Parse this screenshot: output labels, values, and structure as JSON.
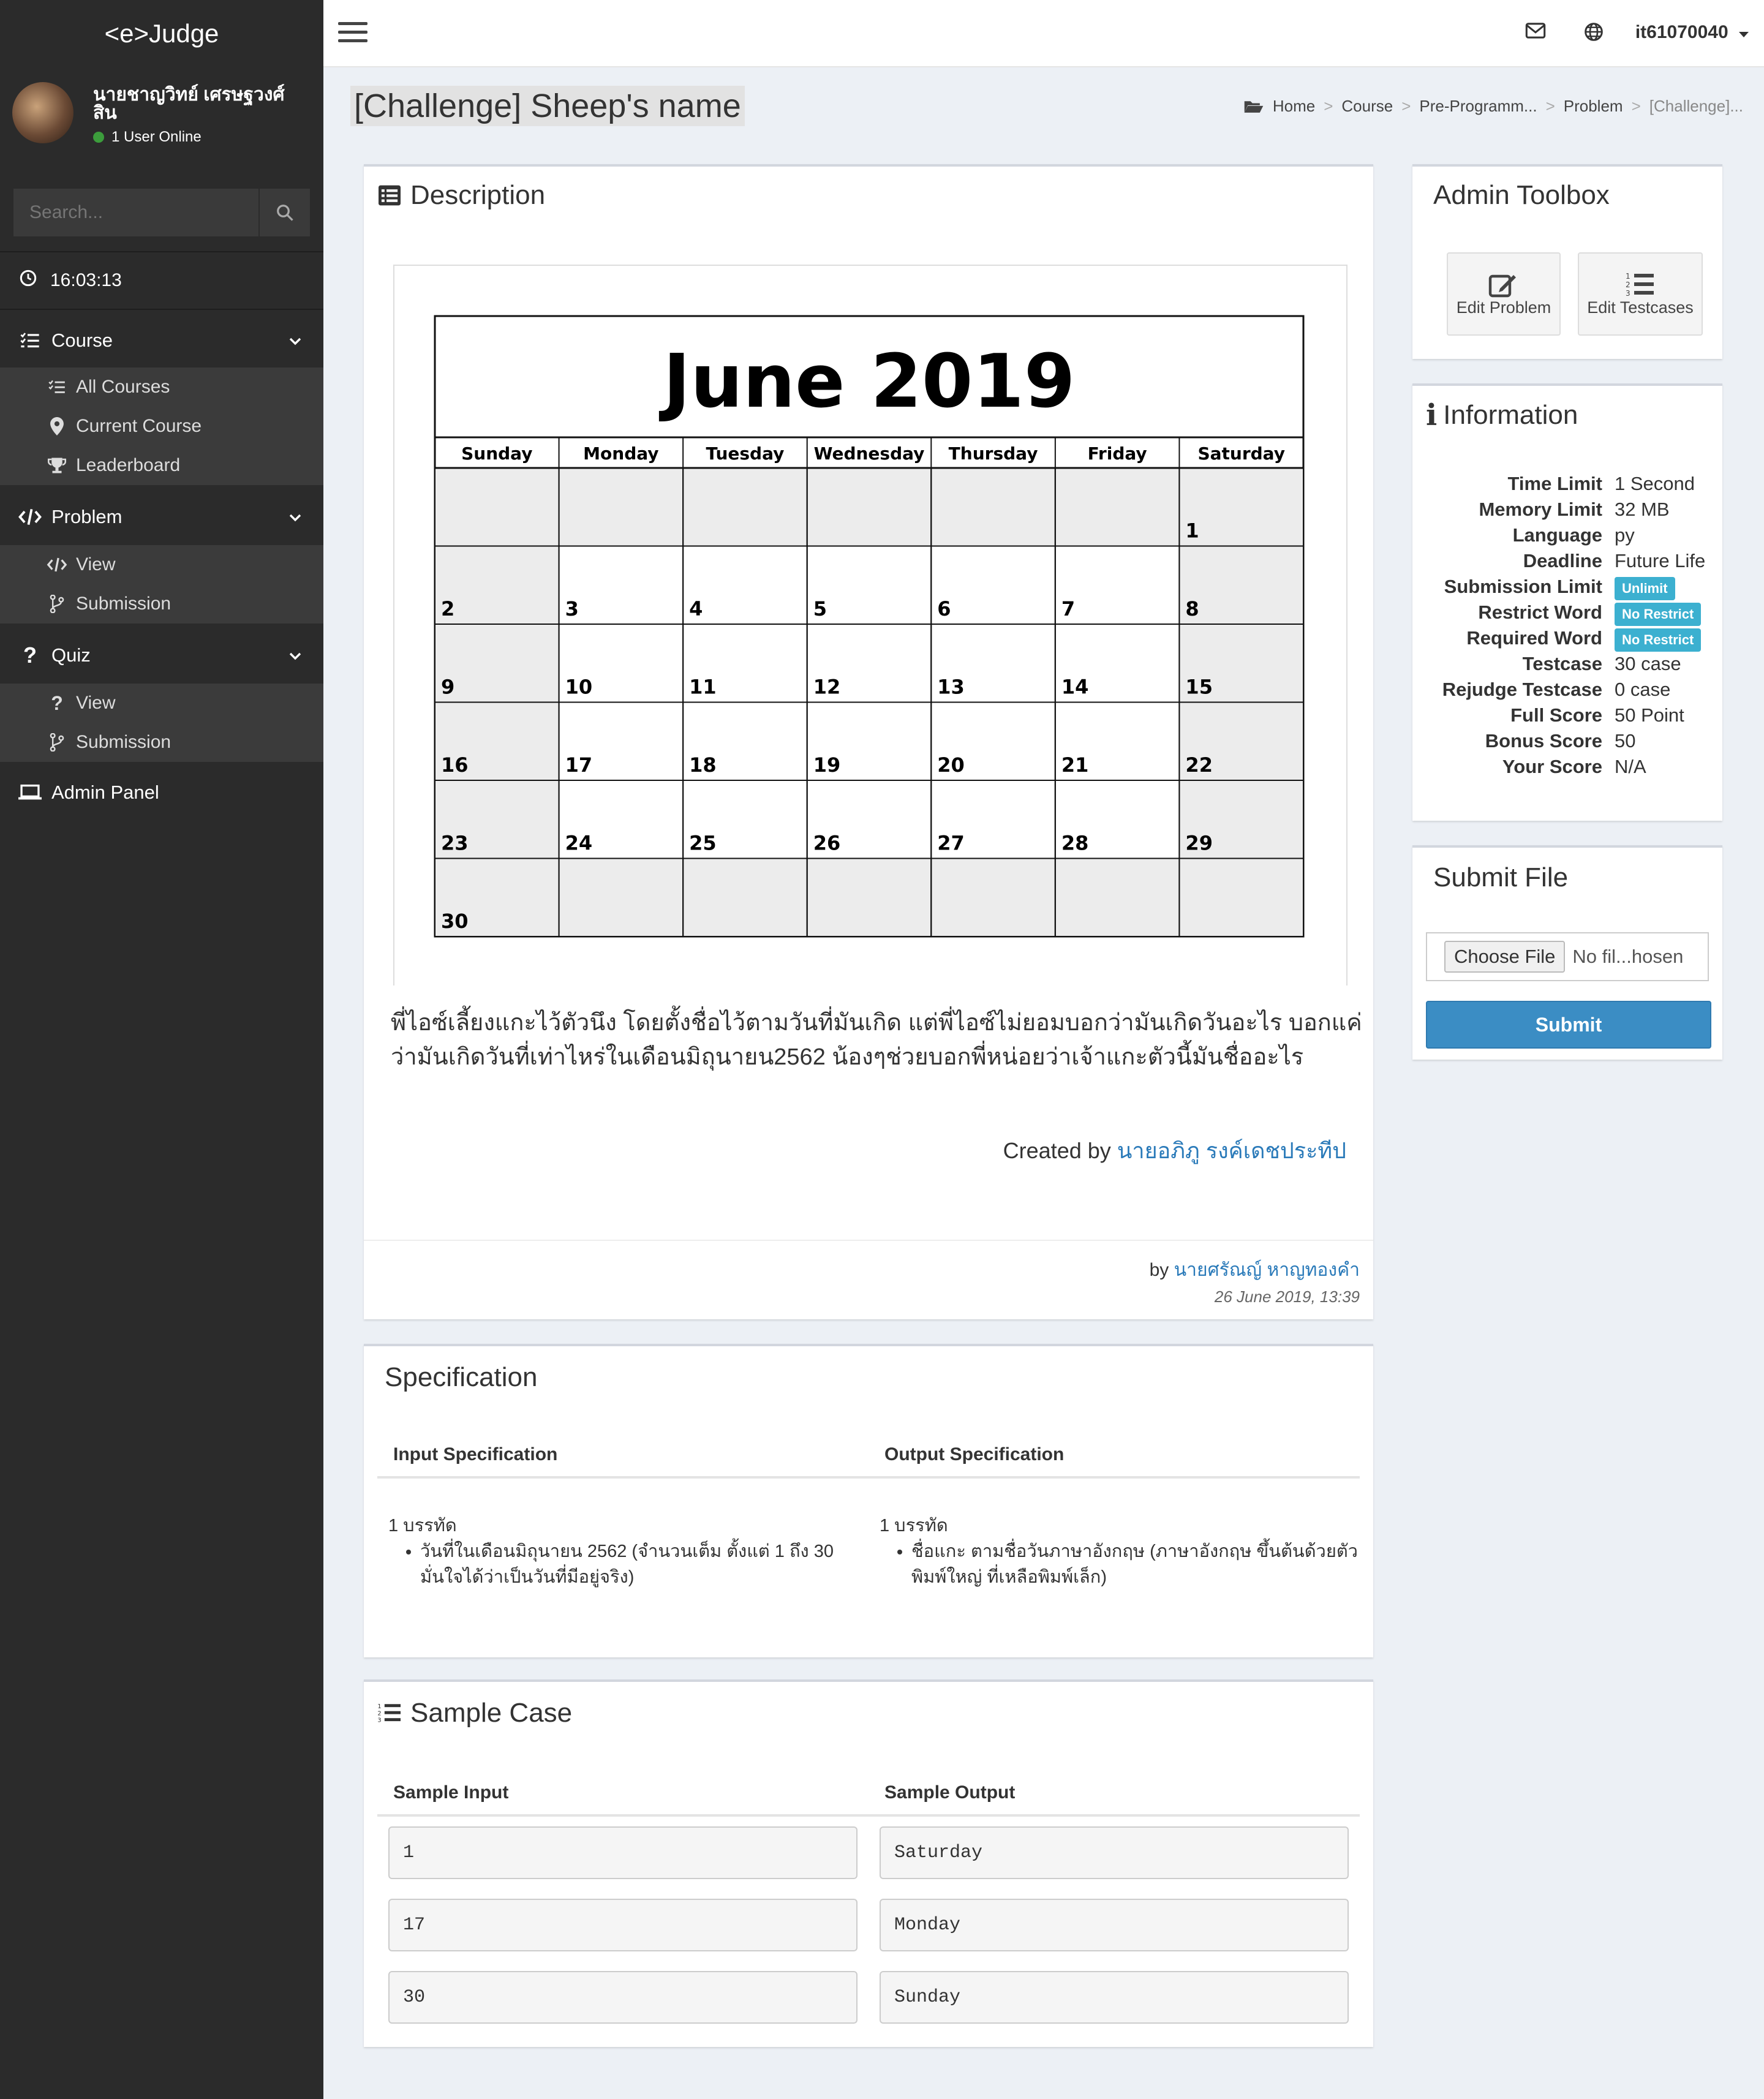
{
  "sidebar": {
    "brand": "<e>Judge",
    "user_name": "นายชาญวิทย์ เศรษฐวงศ์สิน",
    "online_text": "1 User Online",
    "search_placeholder": "Search...",
    "clock": "16:03:13",
    "course": {
      "label": "Course",
      "items": [
        "All Courses",
        "Current Course",
        "Leaderboard"
      ]
    },
    "problem": {
      "label": "Problem",
      "items": [
        "View",
        "Submission"
      ]
    },
    "quiz": {
      "label": "Quiz",
      "items": [
        "View",
        "Submission"
      ]
    },
    "admin": "Admin Panel"
  },
  "topbar": {
    "user": "it61070040"
  },
  "page": {
    "title": "[Challenge] Sheep's name",
    "breadcrumb": [
      "Home",
      "Course",
      "Pre-Programm...",
      "Problem",
      "[Challenge]..."
    ]
  },
  "description": {
    "title": "Description",
    "calendar": {
      "title": "June 2019",
      "days": [
        "Sunday",
        "Monday",
        "Tuesday",
        "Wednesday",
        "Thursday",
        "Friday",
        "Saturday"
      ],
      "weeks": [
        [
          "",
          "",
          "",
          "",
          "",
          "",
          "1"
        ],
        [
          "2",
          "3",
          "4",
          "5",
          "6",
          "7",
          "8"
        ],
        [
          "9",
          "10",
          "11",
          "12",
          "13",
          "14",
          "15"
        ],
        [
          "16",
          "17",
          "18",
          "19",
          "20",
          "21",
          "22"
        ],
        [
          "23",
          "24",
          "25",
          "26",
          "27",
          "28",
          "29"
        ],
        [
          "30",
          "",
          "",
          "",
          "",
          "",
          ""
        ]
      ]
    },
    "text": "พี่ไอซ์เลี้ยงแกะไว้ตัวนึง โดยตั้งชื่อไว้ตามวันที่มันเกิด แต่พี่ไอซ์ไม่ยอมบอกว่ามันเกิดวันอะไร บอกแค่ว่ามันเกิดวันที่เท่าไหร่ในเดือนมิถุนายน2562 น้องๆช่วยบอกพี่หน่อยว่าเจ้าแกะตัวนี้มันชื่ออะไร",
    "created_prefix": "Created by ",
    "created_name": "นายอภิภู รงค์เดชประทีป",
    "by_prefix": "by ",
    "by_name": "นายศรัณญ์ หาญทองคำ",
    "date": "26 June 2019, 13:39"
  },
  "specification": {
    "title": "Specification",
    "input_header": "Input Specification",
    "output_header": "Output Specification",
    "input_line": "1 บรรทัด",
    "input_bullet": "วันที่ในเดือนมิถุนายน 2562 (จำนวนเต็ม ตั้งแต่ 1 ถึง 30 มั่นใจได้ว่าเป็นวันที่มีอยู่จริง)",
    "output_line": "1 บรรทัด",
    "output_bullet": "ชื่อแกะ ตามชื่อวันภาษาอังกฤษ (ภาษาอังกฤษ ขึ้นต้นด้วยตัวพิมพ์ใหญ่ ที่เหลือพิมพ์เล็ก)"
  },
  "sample": {
    "title": "Sample Case",
    "input_header": "Sample Input",
    "output_header": "Sample Output",
    "inputs": [
      "1",
      "17",
      "30"
    ],
    "outputs": [
      "Saturday",
      "Monday",
      "Sunday"
    ]
  },
  "admin_toolbox": {
    "title": "Admin Toolbox",
    "edit_problem": "Edit Problem",
    "edit_testcases": "Edit Testcases"
  },
  "information": {
    "title": "Information",
    "rows": [
      {
        "k": "Time Limit",
        "v": "1 Second"
      },
      {
        "k": "Memory Limit",
        "v": "32 MB"
      },
      {
        "k": "Language",
        "v": "py"
      },
      {
        "k": "Deadline",
        "v": "Future Life"
      },
      {
        "k": "Submission Limit",
        "v": "Unlimit",
        "badge": true
      },
      {
        "k": "Restrict Word",
        "v": "No Restrict",
        "badge": true
      },
      {
        "k": "Required Word",
        "v": "No Restrict",
        "badge": true
      },
      {
        "k": "Testcase",
        "v": "30 case"
      },
      {
        "k": "Rejudge Testcase",
        "v": "0 case"
      },
      {
        "k": "Full Score",
        "v": "50 Point"
      },
      {
        "k": "Bonus Score",
        "v": "50"
      },
      {
        "k": "Your Score",
        "v": "N/A"
      }
    ]
  },
  "submit": {
    "title": "Submit File",
    "choose": "Choose File",
    "no_file": "No fil...hosen",
    "button": "Submit"
  },
  "colors": {
    "sidebar": "#2b2b2b",
    "submenu": "#3b3b3b",
    "link": "#2a7ab9",
    "badge": "#3cb0d0",
    "submit": "#3b8dc4"
  }
}
